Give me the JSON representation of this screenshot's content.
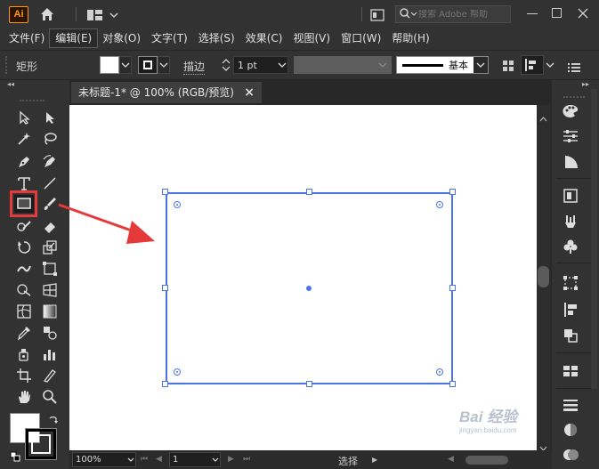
{
  "app": {
    "logo": "Ai"
  },
  "search": {
    "placeholder": "搜索 Adobe 帮助"
  },
  "menu": [
    "文件(F)",
    "编辑(E)",
    "对象(O)",
    "文字(T)",
    "选择(S)",
    "效果(C)",
    "视图(V)",
    "窗口(W)",
    "帮助(H)"
  ],
  "menu_active_index": 1,
  "control": {
    "object_type": "矩形",
    "stroke_label": "描边",
    "stroke_weight": "1 pt",
    "brush_label": "基本"
  },
  "document": {
    "tab_title": "未标题-1* @ 100% (RGB/预览)",
    "close_symbol": "×"
  },
  "status": {
    "zoom": "100%",
    "artboard": "1",
    "tool_name": "选择"
  },
  "watermark": {
    "text": "Bai 经验",
    "subtext": "jingyan.baidu.com"
  },
  "colors": {
    "selection": "#4a74e8",
    "highlight": "#e53a3a",
    "accent": "#d97a26"
  }
}
